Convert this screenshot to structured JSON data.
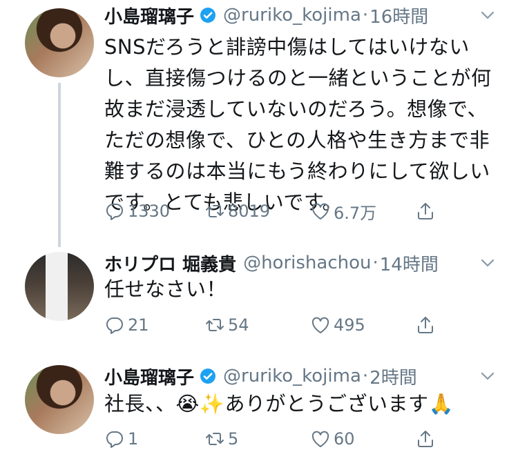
{
  "tweets": [
    {
      "name": "小島瑠璃子",
      "handle": "@ruriko_kojima",
      "separator": "·",
      "time": "16時間",
      "text": "SNSだろうと誹謗中傷はしてはいけないし、直接傷つけるのと一緒ということが何故まだ浸透していないのだろう。想像で、ただの想像で、ひとの人格や生き方まで非難するのは本当にもう終わりにして欲しいです。とても悲しいです。",
      "replies": "1330",
      "retweets": "8019",
      "likes": "6.7万"
    },
    {
      "name": "ホリプロ 堀義貴",
      "handle": "@horishachou",
      "separator": "·",
      "time": "14時間",
      "text": "任せなさい！",
      "replies": "21",
      "retweets": "54",
      "likes": "495"
    },
    {
      "name": "小島瑠璃子",
      "handle": "@ruriko_kojima",
      "separator": "·",
      "time": "2時間",
      "text": "社長、、😭✨ありがとうございます🙏",
      "replies": "1",
      "retweets": "5",
      "likes": "60"
    }
  ],
  "icons": {
    "reply": "reply-icon",
    "retweet": "retweet-icon",
    "like": "heart-icon",
    "share": "share-icon",
    "more": "chevron-down-icon",
    "verified": "verified-badge-icon"
  },
  "colors": {
    "text": "#14171a",
    "secondary": "#657786",
    "verified": "#1da1f2",
    "thread_line": "#ccd6dd"
  }
}
